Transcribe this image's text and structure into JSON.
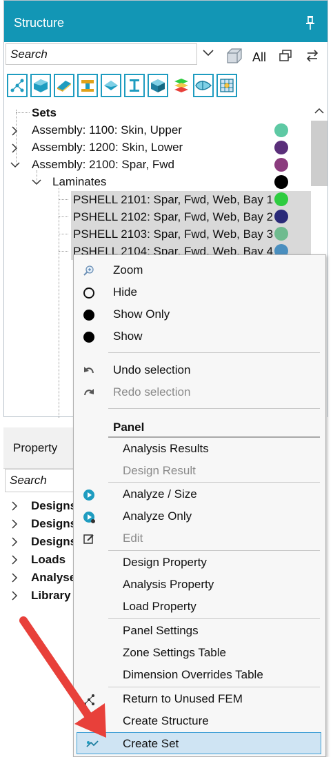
{
  "structure": {
    "title": "Structure",
    "search_placeholder": "Search",
    "all_label": "All",
    "toolbar_icons": [
      "nodes-icon",
      "solid-block-icon",
      "plate-icon",
      "beam-icon",
      "diamond-plate-icon",
      "i-beam-icon",
      "cube-icon",
      "layers-icon",
      "airfoil-icon",
      "grid-panel-icon"
    ],
    "tree": {
      "sets_label": "Sets",
      "assemblies": [
        {
          "label": "Assembly: 1100: Skin, Upper",
          "color": "#5ec9a4"
        },
        {
          "label": "Assembly: 1200: Skin, Lower",
          "color": "#5a2f7a"
        },
        {
          "label": "Assembly: 2100: Spar, Fwd",
          "color": "#8b3c7e"
        }
      ],
      "laminates_label": "Laminates",
      "laminates_color": "#000000",
      "pshells": [
        {
          "label": "PSHELL 2101: Spar, Fwd, Web, Bay 1",
          "color": "#2ecc40"
        },
        {
          "label": "PSHELL 2102: Spar, Fwd, Web, Bay 2",
          "color": "#2a2a78"
        },
        {
          "label": "PSHELL 2103: Spar, Fwd, Web, Bay 3",
          "color": "#6fbb8f"
        },
        {
          "label": "PSHELL 2104: Spar, Fwd, Web, Bay 4",
          "color": "#4a8fbf"
        }
      ]
    }
  },
  "property": {
    "title": "Property",
    "search_placeholder": "Search",
    "items": [
      "Designs",
      "Designs",
      "Designs",
      "Loads",
      "Analyse",
      "Library"
    ]
  },
  "context_menu": {
    "items_top": [
      {
        "label": "Zoom",
        "icon": "zoom-icon"
      },
      {
        "label": "Hide",
        "icon": "hollow-circle-icon"
      },
      {
        "label": "Show Only",
        "icon": "filled-circle-icon"
      },
      {
        "label": "Show",
        "icon": "filled-circle-icon"
      }
    ],
    "undo": "Undo selection",
    "redo": "Redo selection",
    "panel_header": "Panel",
    "analysis_results": "Analysis Results",
    "design_result": "Design Result",
    "analyze_size": "Analyze / Size",
    "analyze_only": "Analyze Only",
    "edit": "Edit",
    "design_property": "Design Property",
    "analysis_property": "Analysis Property",
    "load_property": "Load Property",
    "panel_settings": "Panel Settings",
    "zone_settings_table": "Zone Settings Table",
    "dimension_overrides_table": "Dimension Overrides Table",
    "return_unused_fem": "Return to Unused FEM",
    "create_structure": "Create Structure",
    "create_set": "Create Set"
  },
  "colors": {
    "header_bg": "#1296b5",
    "accent": "#1e9cc0",
    "selected_bg": "#cfe4f3",
    "arrow": "#e8403a"
  }
}
